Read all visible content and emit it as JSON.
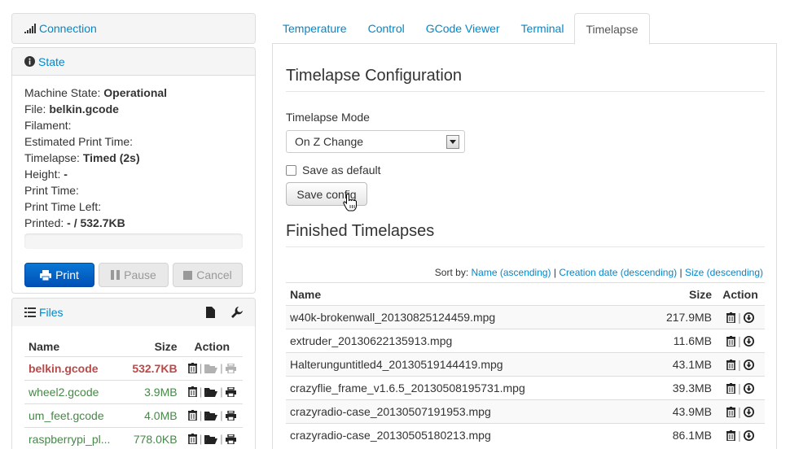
{
  "sidebar": {
    "connection": {
      "title": "Connection"
    },
    "state": {
      "title": "State",
      "lines": [
        {
          "label": "Machine State:",
          "value": "Operational"
        },
        {
          "label": "File:",
          "value": "belkin.gcode"
        },
        {
          "label": "Filament:",
          "value": ""
        },
        {
          "label": "Estimated Print Time:",
          "value": ""
        },
        {
          "label": "Timelapse:",
          "value": "Timed (2s)"
        },
        {
          "label": "Height:",
          "value": "-"
        },
        {
          "label": "Print Time:",
          "value": ""
        },
        {
          "label": "Print Time Left:",
          "value": ""
        },
        {
          "label": "Printed:",
          "value": "- / 532.7KB"
        }
      ],
      "progress": 0,
      "buttons": {
        "print": "Print",
        "pause": "Pause",
        "cancel": "Cancel"
      }
    },
    "files": {
      "title": "Files",
      "headers": {
        "name": "Name",
        "size": "Size",
        "action": "Action"
      },
      "rows": [
        {
          "name": "belkin.gcode",
          "size": "532.7KB",
          "active": true
        },
        {
          "name": "wheel2.gcode",
          "size": "3.9MB",
          "active": false
        },
        {
          "name": "um_feet.gcode",
          "size": "4.0MB",
          "active": false
        },
        {
          "name": "raspberrypi_pl...",
          "size": "778.0KB",
          "active": false
        }
      ]
    }
  },
  "tabs": [
    "Temperature",
    "Control",
    "GCode Viewer",
    "Terminal",
    "Timelapse"
  ],
  "active_tab": "Timelapse",
  "timelapse": {
    "config_title": "Timelapse Configuration",
    "mode_label": "Timelapse Mode",
    "mode_value": "On Z Change",
    "save_default_label": "Save as default",
    "save_default_checked": false,
    "save_button": "Save config",
    "finished_title": "Finished Timelapses",
    "sort_by_label": "Sort by:",
    "sort_options": [
      "Name (ascending)",
      "Creation date (descending)",
      "Size (descending)"
    ],
    "headers": {
      "name": "Name",
      "size": "Size",
      "action": "Action"
    },
    "rows": [
      {
        "name": "w40k-brokenwall_20130825124459.mpg",
        "size": "217.9MB"
      },
      {
        "name": "extruder_20130622135913.mpg",
        "size": "11.6MB"
      },
      {
        "name": "Halterunguntitled4_20130519144419.mpg",
        "size": "43.1MB"
      },
      {
        "name": "crazyflie_frame_v1.6.5_20130508195731.mpg",
        "size": "39.3MB"
      },
      {
        "name": "crazyradio-case_20130507191953.mpg",
        "size": "43.9MB"
      },
      {
        "name": "crazyradio-case_20130505180213.mpg",
        "size": "86.1MB"
      }
    ]
  },
  "colors": {
    "link": "#0088cc",
    "primary": "#0a6fd0",
    "active_file": "#b94a48",
    "file": "#468847"
  },
  "icons": [
    "signal-icon",
    "info-icon",
    "print-icon",
    "pause-icon",
    "stop-icon",
    "list-icon",
    "file-icon",
    "wrench-icon",
    "trash-icon",
    "folder-open-icon",
    "download-icon",
    "select-arrow-icon",
    "hand-cursor-icon"
  ]
}
